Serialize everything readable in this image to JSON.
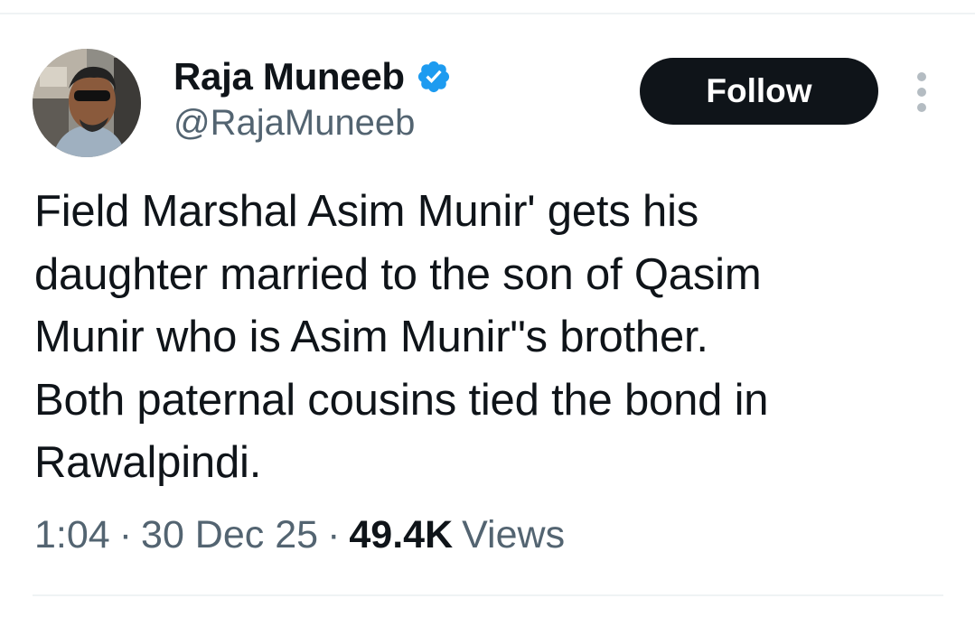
{
  "author": {
    "display_name": "Raja Muneeb",
    "handle": "@RajaMuneeb",
    "verified": true,
    "verified_color": "#1d9bf0"
  },
  "actions": {
    "follow_label": "Follow",
    "more_icon": "more-vertical-icon"
  },
  "tweet": {
    "text": "Field Marshal Asim Munir' gets his\ndaughter married to the son of Qasim\nMunir who is Asim Munir\"s brother.\nBoth paternal cousins tied the bond in\nRawalpindi."
  },
  "meta": {
    "time": "1:04",
    "separator": "·",
    "date": "30 Dec 25",
    "views_count": "49.4K",
    "views_label": "Views"
  },
  "colors": {
    "text_primary": "#0f1419",
    "text_secondary": "#536471",
    "follow_bg": "#0f1419",
    "divider": "#eff3f4"
  }
}
